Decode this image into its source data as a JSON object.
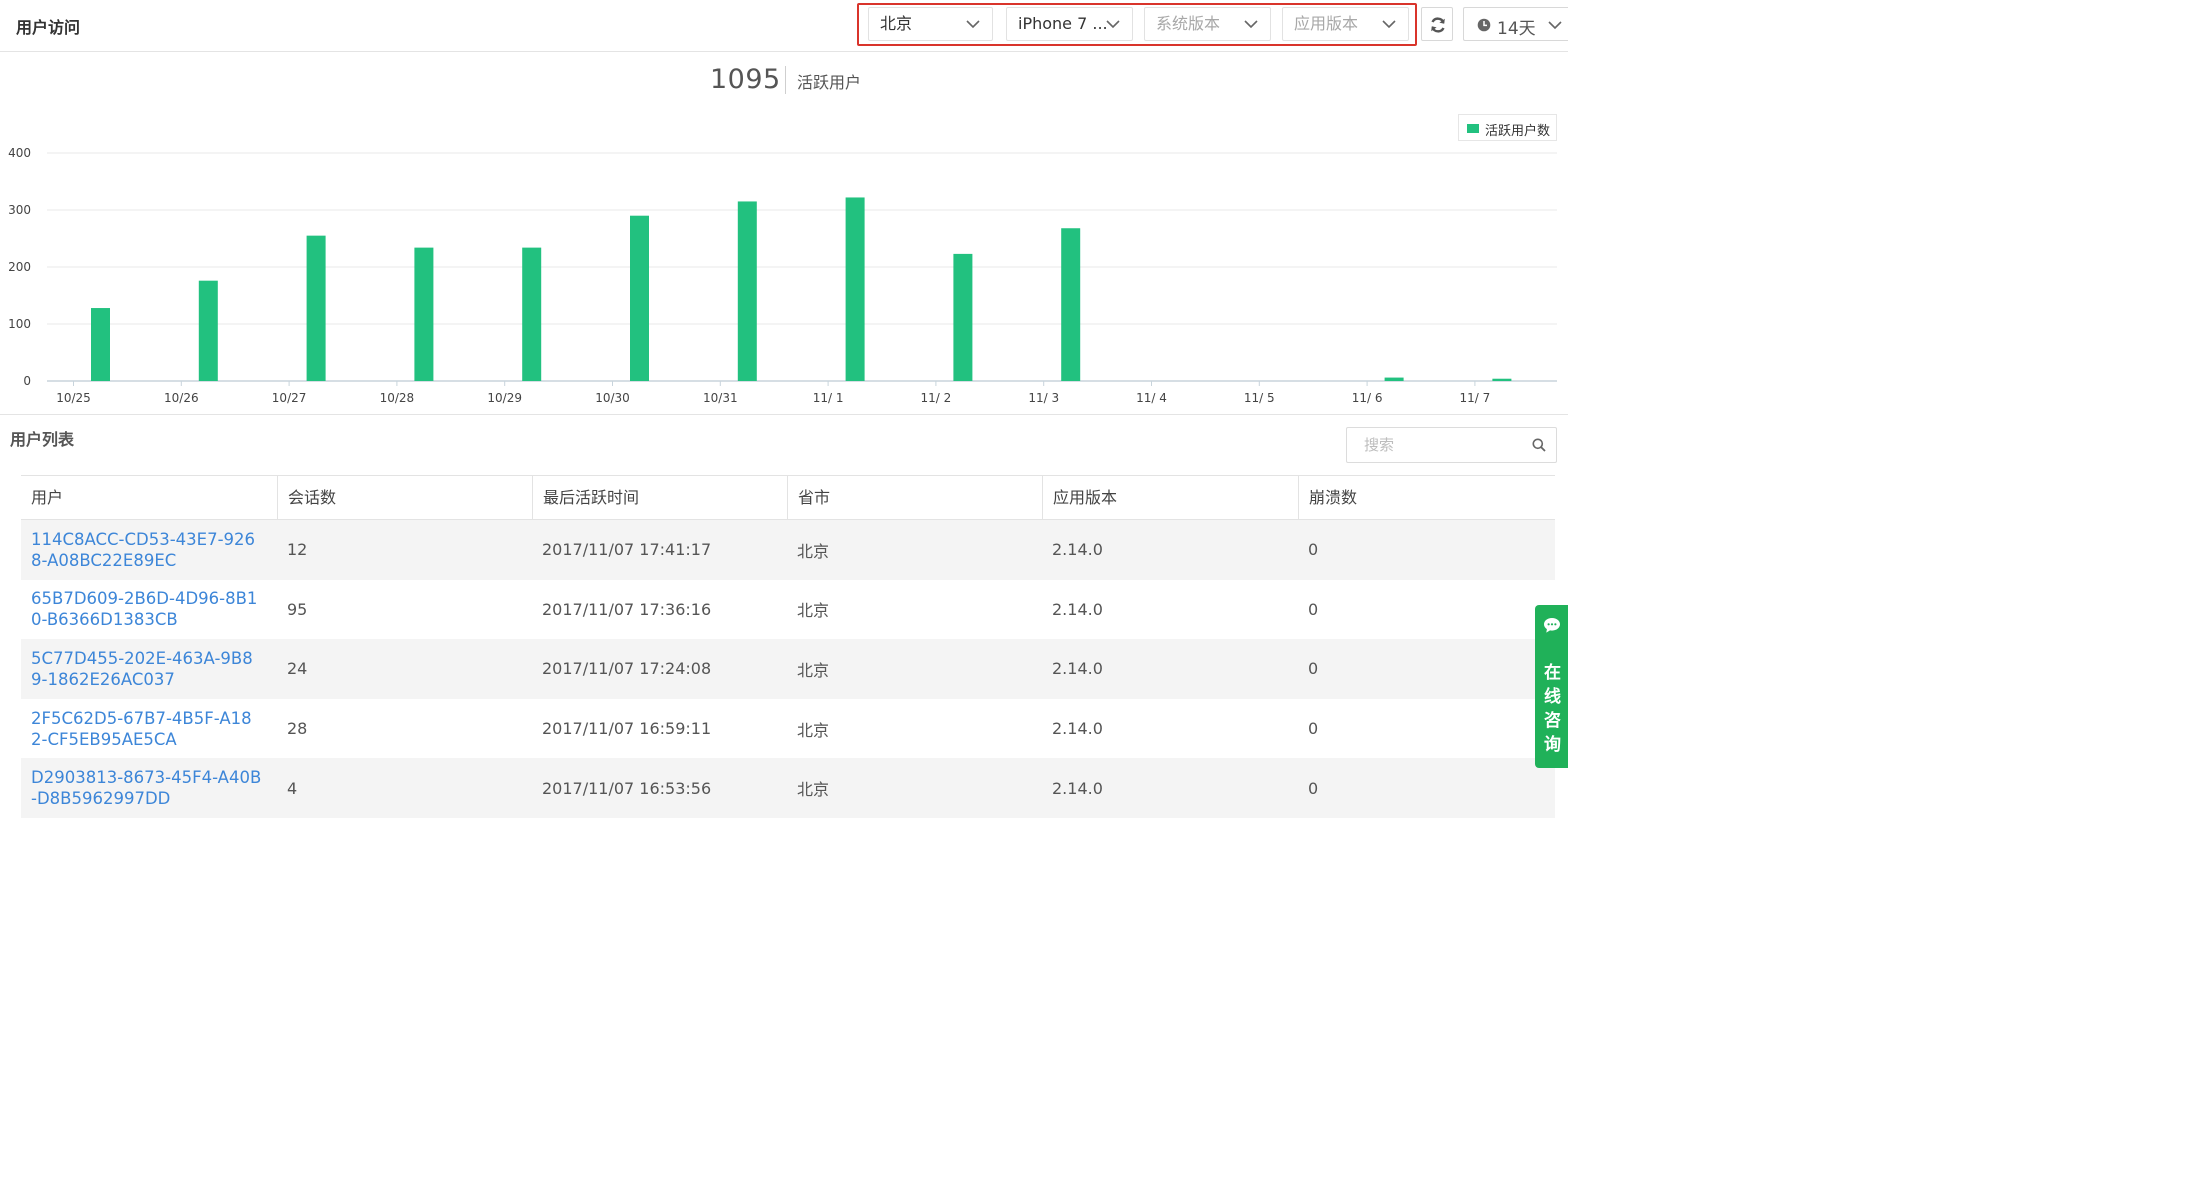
{
  "page": {
    "title": "用户访问"
  },
  "filters": {
    "city": {
      "value": "北京"
    },
    "device": {
      "value": "iPhone 7 ..."
    },
    "os_version": {
      "placeholder": "系统版本"
    },
    "app_version": {
      "placeholder": "应用版本"
    }
  },
  "time_range": {
    "label": "14天"
  },
  "kpi": {
    "value": "1095",
    "label": "活跃用户"
  },
  "colors": {
    "series": "#22c17f",
    "link": "#3d86d8",
    "highlight_border": "#d9342b",
    "consult_bg": "#20b159"
  },
  "chart_data": {
    "type": "bar",
    "categories": [
      "10/25",
      "10/26",
      "10/27",
      "10/28",
      "10/29",
      "10/30",
      "10/31",
      "11/ 1",
      "11/ 2",
      "11/ 3",
      "11/ 4",
      "11/ 5",
      "11/ 6",
      "11/ 7"
    ],
    "series": [
      {
        "name": "活跃用户数",
        "values": [
          128,
          176,
          255,
          234,
          234,
          290,
          315,
          322,
          223,
          268,
          0,
          0,
          6,
          4
        ]
      }
    ],
    "ylim": [
      0,
      400
    ],
    "yticks": [
      0,
      100,
      200,
      300,
      400
    ],
    "grid": true,
    "legend": "top-right"
  },
  "user_list": {
    "title": "用户列表",
    "search_placeholder": "搜索",
    "columns": [
      "用户",
      "会话数",
      "最后活跃时间",
      "省市",
      "应用版本",
      "崩溃数"
    ],
    "rows": [
      [
        "114C8ACC-CD53-43E7-9268-A08BC22E89EC",
        "12",
        "2017/11/07 17:41:17",
        "北京",
        "2.14.0",
        "0"
      ],
      [
        "65B7D609-2B6D-4D96-8B10-B6366D1383CB",
        "95",
        "2017/11/07 17:36:16",
        "北京",
        "2.14.0",
        "0"
      ],
      [
        "5C77D455-202E-463A-9B89-1862E26AC037",
        "24",
        "2017/11/07 17:24:08",
        "北京",
        "2.14.0",
        "0"
      ],
      [
        "2F5C62D5-67B7-4B5F-A182-CF5EB95AE5CA",
        "28",
        "2017/11/07 16:59:11",
        "北京",
        "2.14.0",
        "0"
      ],
      [
        "D2903813-8673-45F4-A40B-D8B5962997DD",
        "4",
        "2017/11/07 16:53:56",
        "北京",
        "2.14.0",
        "0"
      ]
    ]
  },
  "consult": {
    "label": "在线咨询"
  }
}
